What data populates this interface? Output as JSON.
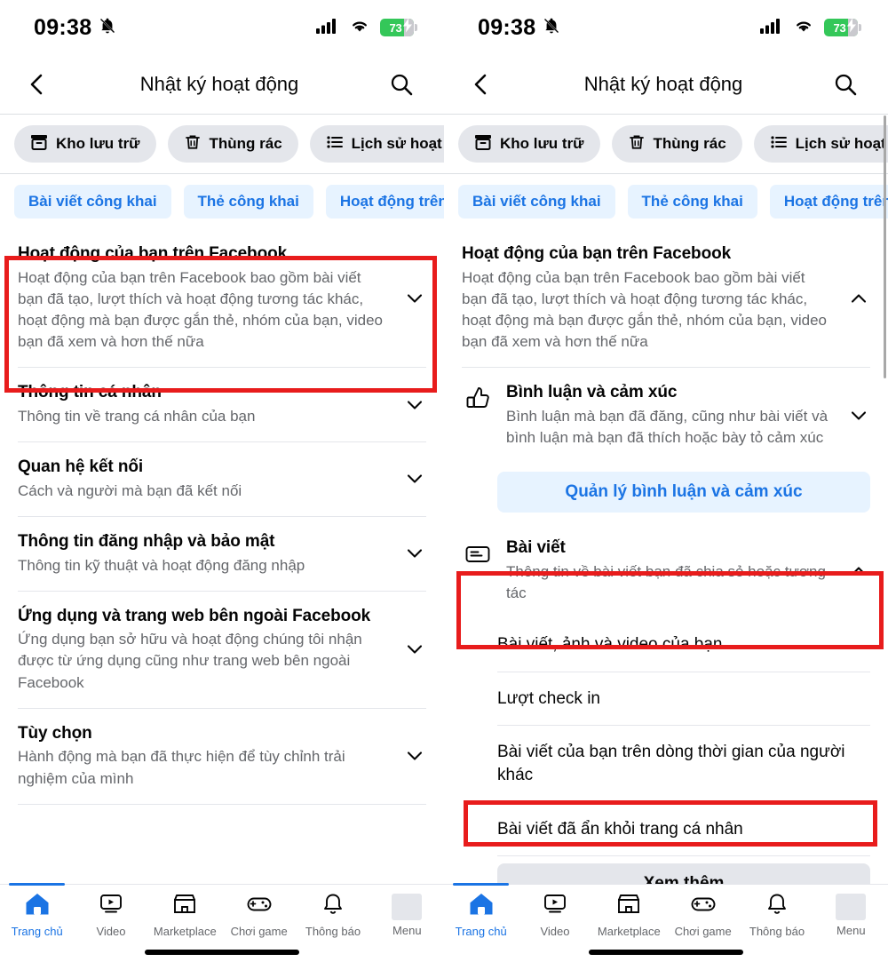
{
  "status_bar": {
    "time": "09:38",
    "mute_icon": "bell-slash-icon",
    "signal_icon": "cellular-signal-icon",
    "wifi_icon": "wifi-icon",
    "battery_percent": "73",
    "battery_color": "#34C759",
    "charging_icon": "bolt-icon"
  },
  "header": {
    "back_icon": "chevron-left-icon",
    "title": "Nhật ký hoạt động",
    "search_icon": "search-icon"
  },
  "filter_chips": [
    {
      "label": "Kho lưu trữ",
      "icon": "archive-box-icon"
    },
    {
      "label": "Thùng rác",
      "icon": "trash-icon"
    },
    {
      "label": "Lịch sử hoạt động",
      "icon": "list-bullet-icon"
    }
  ],
  "category_chips": [
    {
      "label": "Bài viết công khai"
    },
    {
      "label": "Thẻ công khai"
    },
    {
      "label": "Hoạt động trên"
    }
  ],
  "colors": {
    "accent_blue": "#1B74E4",
    "chip_blue_bg": "#E7F3FF",
    "chip_grey_bg": "#E4E6EB",
    "highlight_red": "#E81C1C",
    "text_primary": "#050505",
    "text_secondary": "#65676B"
  },
  "left_screen": {
    "rows": [
      {
        "title": "Hoạt động của bạn trên Facebook",
        "subtitle": "Hoạt động của bạn trên Facebook bao gồm bài viết bạn đã tạo, lượt thích và hoạt động tương tác khác, hoạt động mà bạn được gắn thẻ, nhóm của bạn, video bạn đã xem và hơn thế nữa",
        "chevron": "chevron-down-icon",
        "highlighted": true
      },
      {
        "title": "Thông tin cá nhân",
        "subtitle": "Thông tin về trang cá nhân của bạn",
        "chevron": "chevron-down-icon",
        "highlighted": false
      },
      {
        "title": "Quan hệ kết nối",
        "subtitle": "Cách và người mà bạn đã kết nối",
        "chevron": "chevron-down-icon",
        "highlighted": false
      },
      {
        "title": "Thông tin đăng nhập và bảo mật",
        "subtitle": "Thông tin kỹ thuật và hoạt động đăng nhập",
        "chevron": "chevron-down-icon",
        "highlighted": false
      },
      {
        "title": "Ứng dụng và trang web bên ngoài Facebook",
        "subtitle": "Ứng dụng bạn sở hữu và hoạt động chúng tôi nhận được từ ứng dụng cũng như trang web bên ngoài Facebook",
        "chevron": "chevron-down-icon",
        "highlighted": false
      },
      {
        "title": "Tùy chọn",
        "subtitle": "Hành động mà bạn đã thực hiện để tùy chỉnh trải nghiệm của mình",
        "chevron": "chevron-down-icon",
        "highlighted": false
      }
    ]
  },
  "right_screen": {
    "header_row": {
      "title": "Hoạt động của bạn trên Facebook",
      "subtitle": "Hoạt động của bạn trên Facebook bao gồm bài viết bạn đã tạo, lượt thích và hoạt động tương tác khác, hoạt động mà bạn được gắn thẻ, nhóm của bạn, video bạn đã xem và hơn thế nữa",
      "chevron": "chevron-up-icon"
    },
    "comments_row": {
      "icon": "thumbs-up-icon",
      "title": "Bình luận và cảm xúc",
      "subtitle": "Bình luận mà bạn đã đăng, cũng như bài viết và bình luận mà bạn đã thích hoặc bày tỏ cảm xúc",
      "chevron": "chevron-down-icon"
    },
    "manage_button": "Quản lý bình luận và cảm xúc",
    "posts_row": {
      "icon": "post-card-icon",
      "title": "Bài viết",
      "subtitle": "Thông tin về bài viết bạn đã chia sẻ hoặc tương tác",
      "chevron": "chevron-up-icon",
      "highlighted": true
    },
    "posts_subitems": [
      {
        "label": "Bài viết, ảnh và video của bạn",
        "highlighted": false
      },
      {
        "label": "Lượt check in",
        "highlighted": false
      },
      {
        "label": "Bài viết của bạn trên dòng thời gian của người khác",
        "highlighted": false
      },
      {
        "label": "Bài viết đã ẩn khỏi trang cá nhân",
        "highlighted": true
      }
    ],
    "see_more_button": "Xem thêm"
  },
  "bottom_nav": [
    {
      "label": "Trang chủ",
      "icon": "home-icon",
      "active": true
    },
    {
      "label": "Video",
      "icon": "video-icon",
      "active": false
    },
    {
      "label": "Marketplace",
      "icon": "marketplace-icon",
      "active": false
    },
    {
      "label": "Chơi game",
      "icon": "gamepad-icon",
      "active": false
    },
    {
      "label": "Thông báo",
      "icon": "bell-icon",
      "active": false
    },
    {
      "label": "Menu",
      "icon": "menu-icon",
      "active": false
    }
  ]
}
